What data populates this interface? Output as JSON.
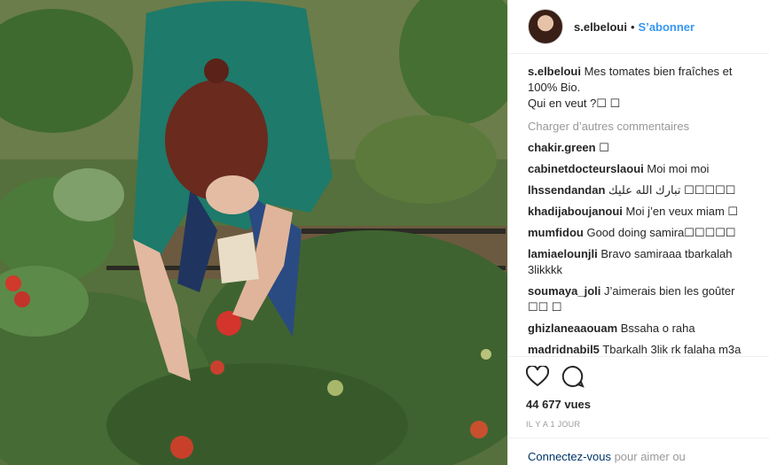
{
  "post": {
    "author": "s.elbeloui",
    "follow_label": "S’abonner",
    "separator": "•",
    "caption_text": "Mes tomates bien fraîches et 100% Bio.",
    "caption_line2": "Qui en veut ?☐ ☐",
    "load_more": "Charger d’autres commentaires",
    "comments": [
      {
        "user": "chakir.green",
        "text": "☐"
      },
      {
        "user": "cabinetdocteurslaoui",
        "text": "Moi moi moi"
      },
      {
        "user": "lhssendandan",
        "text": "تبارك الله عليك ☐☐☐☐☐"
      },
      {
        "user": "khadijaboujanoui",
        "text": "Moi j’en veux miam ☐"
      },
      {
        "user": "mumfidou",
        "text": "Good doing samira☐☐☐☐☐"
      },
      {
        "user": "lamiaelounjli",
        "text": "Bravo samiraaa tbarkalah 3likkkk"
      },
      {
        "user": "soumaya_joli",
        "text": "J’aimerais bien les goûter ☐☐ ☐"
      },
      {
        "user": "ghizlaneaaouam",
        "text": "Bssaha o raha"
      },
      {
        "user": "madridnabil5",
        "text": "Tbarkalh 3lik rk falaha m3a"
      }
    ],
    "views": "44 677 vues",
    "time_ago": "IL Y A 1 JOUR",
    "footer_link": "Connectez-vous",
    "footer_text": " pour aimer ou"
  }
}
